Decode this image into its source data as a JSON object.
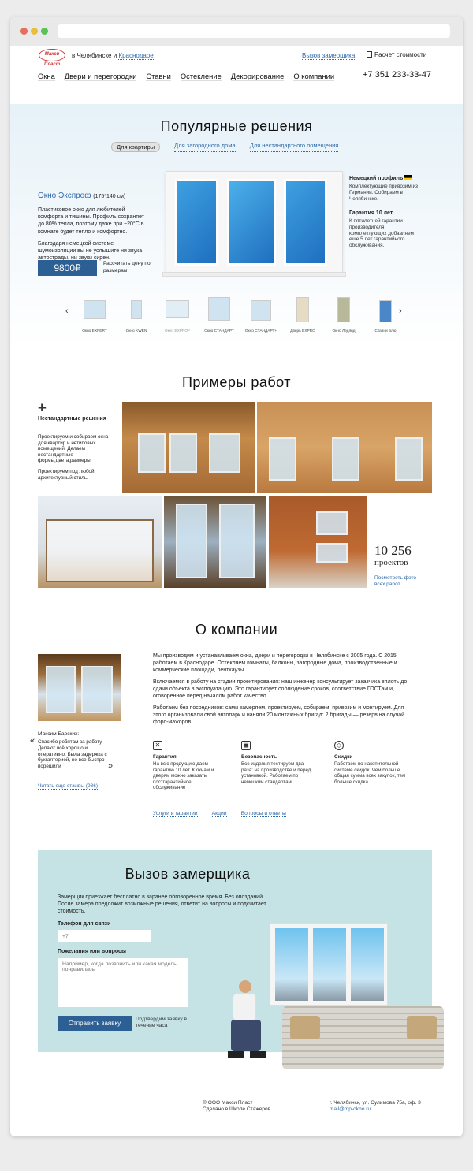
{
  "header": {
    "logo_text": "Макси Пласт",
    "city_prefix": "в Челябинске и",
    "city_link": "Краснодаре",
    "call_link": "Вызов замерщика",
    "calc_link": "Расчет стоимости",
    "phone": "+7 351 233-33-47",
    "nav": [
      "Окна",
      "Двери и перегородки",
      "Ставни",
      "Остекление",
      "Декорирование",
      "О компании"
    ]
  },
  "popular": {
    "title": "Популярные решения",
    "tabs": [
      "Для квартиры",
      "Для загородного дома",
      "Для нестандартного помещения"
    ],
    "product_name": "Окно Экспроф",
    "product_size": "(175*140 см)",
    "desc1": "Пластиковое окно для любителей комфорта и тишины. Профиль сохраняет до 80% тепла, поэтому даже при −20°С в комнате будет тепло и комфортно.",
    "desc2": "Благодаря немецкой системе шумоизоляции вы не услышите ни звука автострады, ни звуки сирен.",
    "price": "9800₽",
    "price_note": "Рассчитать цену по размерам",
    "feature1_title": "Немецкий профиль",
    "feature1_text": "Комплектующие привозим из Германии. Собираем в Челябинске.",
    "feature2_title": "Гарантия 10 лет",
    "feature2_text": "К пятилетней гарантии производителя комплектующих добавляем еще 5 лет гарантийного обслуживания.",
    "thumbs": [
      "Окно EXPERT",
      "Окно KWEN",
      "Окно EXPROF",
      "Окно СТАНДАРТ",
      "Окно СТАНДАРТ+",
      "Дверь EXPRO",
      "Окно Ледянд",
      "Ставни Блю"
    ]
  },
  "works": {
    "title": "Примеры работ",
    "side_title": "Нестандартные решения",
    "side_text1": "Проектируем и собираем окна для квартир и нетиповых помещений. Делаем нестандартные формы,цвета,размеры.",
    "side_text2": "Проектируем под любой архитектурный стиль.",
    "count": "10 256",
    "count_label": "проектов",
    "all_link": "Посмотреть фото всех работ"
  },
  "about": {
    "title": "О компании",
    "p1": "Мы производим и устанавливаем окна, двери и перегородки в Челябинске с 2005 года. С 2015 работаем в Краснодаре. Остекляем комнаты, балконы, загородные дома, производственные и коммерческие площади, пентхаузы.",
    "p2": "Включаемся в работу на стадии проектирования: наш инженер консультирует заказчика вплоть до сдачи объекта в эксплуатацию. Это гарантирует соблюдение сроков, соответствие ГОСТам и, оговоренное перед началом работ качество.",
    "p3": "Работаем без посредников: сами замеряем, проектируем, собираем, привозим и монтируем. Для этого организовали свой автопарк и наняли 20 монтажных бригад: 2 бригады — резерв на случай форс-мажоров.",
    "review_author": "Максим Барских:",
    "review_text": "Спасибо ребятам за работу. Делают всё хорошо и оперативно. Была задержка с бухгалтерией, но все быстро порешили",
    "reviews_link": "Читать еще отзывы (936)",
    "blocks": [
      {
        "title": "Гарантия",
        "text": "На всю продукцию даем гарантию 10 лет. К окнам и дверям можно заказать постгарантийное обслуживание"
      },
      {
        "title": "Безопасность",
        "text": "Все изделия тестируем два раза: на производстве и перед установкой. Работаем по немецким стандартам"
      },
      {
        "title": "Скидки",
        "text": "Работаем по накопительной системе скидок. Чем больше общая сумма всех закупок, тем больше скидка"
      }
    ],
    "links": [
      "Услуги и гарантии",
      "Акции",
      "Вопросы и ответы"
    ]
  },
  "form": {
    "title": "Вызов замерщика",
    "intro": "Замерщик приезжает бесплатно в заранее обговоренное время. Без опозданий. После замера предложит возможные решения, ответит на вопросы и подсчитает стоимость.",
    "phone_label": "Телефон для связи",
    "phone_placeholder": "+7",
    "wish_label": "Пожелания или вопросы",
    "wish_placeholder": "Например, когда позвонить или какая модель понравилась",
    "submit": "Отправить заявку",
    "submit_note": "Подтвердим заявку в течение часа"
  },
  "footer": {
    "company": "© ООО Макси Пласт",
    "made": "Сделано в Школе Стажеров",
    "address": "г. Челябинск, ул. Сулимова 75а, оф. 3",
    "email": "mail@mp-okno.ru"
  },
  "colors": {
    "accent": "#2c5f94",
    "link": "#2f6aa8",
    "form_bg": "#c5e3e5"
  }
}
